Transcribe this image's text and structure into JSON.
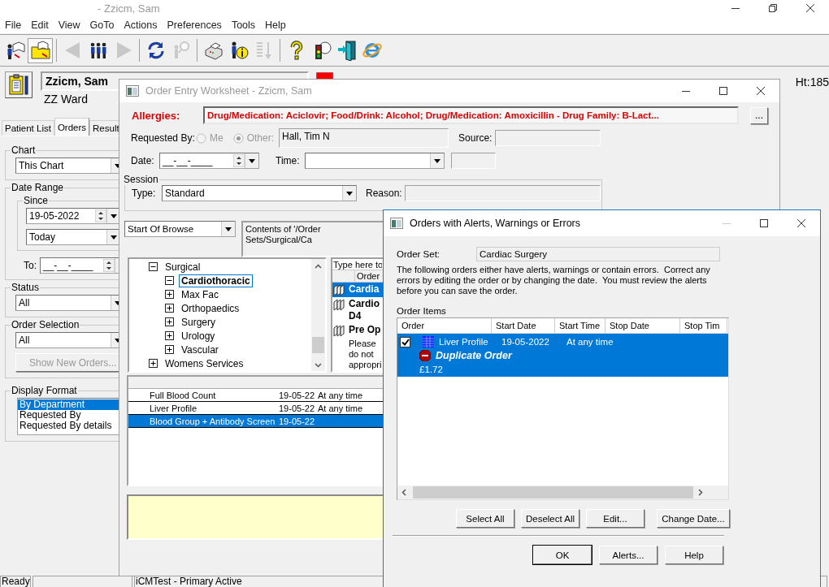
{
  "app": {
    "title": "- Zzicm, Sam",
    "menu": [
      "File",
      "Edit",
      "View",
      "GoTo",
      "Actions",
      "Preferences",
      "Tools",
      "Help"
    ],
    "toolbar": [
      [
        {
          "kind": "chart",
          "pressed": false,
          "disabled": false
        },
        {
          "kind": "folder",
          "pressed": true,
          "disabled": false
        }
      ],
      [
        {
          "kind": "back",
          "pressed": false,
          "disabled": true
        },
        {
          "kind": "people",
          "pressed": false,
          "disabled": false
        },
        {
          "kind": "forward",
          "pressed": false,
          "disabled": true
        }
      ],
      [
        {
          "kind": "refresh",
          "pressed": false,
          "disabled": false
        },
        {
          "kind": "find",
          "pressed": false,
          "disabled": true
        }
      ],
      [
        {
          "kind": "printer",
          "pressed": false,
          "disabled": false
        },
        {
          "kind": "info",
          "pressed": false,
          "disabled": false
        },
        {
          "kind": "sort",
          "pressed": false,
          "disabled": true
        }
      ],
      [
        {
          "kind": "help",
          "pressed": false,
          "disabled": false
        },
        {
          "kind": "traffic",
          "pressed": false,
          "disabled": false
        },
        {
          "kind": "exit",
          "pressed": false,
          "disabled": false
        },
        {
          "kind": "browser",
          "pressed": false,
          "disabled": false
        }
      ]
    ],
    "patient": {
      "name": "Zzicm, Sam",
      "ward": "ZZ Ward",
      "height": "Ht:185"
    }
  },
  "left_panel": {
    "tabs": [
      {
        "label": "Patient List",
        "selected": false
      },
      {
        "label": "Orders",
        "selected": true
      },
      {
        "label": "Result",
        "selected": false
      }
    ],
    "chart": {
      "label": "Chart",
      "value": "This Chart"
    },
    "date_range": {
      "label": "Date Range",
      "since_label": "Since",
      "since_value": "19-05-2022",
      "period": "Today",
      "to_label": "To:",
      "to_value": "__-__-____"
    },
    "status": {
      "label": "Status",
      "value": "All"
    },
    "order_selection": {
      "label": "Order Selection",
      "value": "All",
      "button": {
        "label": "Show New Orders...",
        "disabled": true
      }
    },
    "display_format": {
      "label": "Display Format",
      "items": [
        {
          "label": "By Department",
          "selected": true
        },
        {
          "label": "Requested By",
          "selected": false
        },
        {
          "label": "Requested By details",
          "selected": false
        }
      ]
    }
  },
  "worksheet": {
    "title": "Order Entry Worksheet - Zzicm, Sam",
    "allergies_label": "Allergies:",
    "allergies": "Drug/Medication: Aciclovir; Food/Drink: Alcohol; Drug/Medication: Amoxicillin - Drug Family: B-Lact...",
    "allergies_button": "...",
    "requested_by_label": "Requested By:",
    "requester_options": [
      {
        "label": "Me",
        "selected": false,
        "disabled": true
      },
      {
        "label": "Other:",
        "selected": true,
        "disabled": true
      }
    ],
    "requested_by": "Hall, Tim N",
    "source_label": "Source:",
    "date_label": "Date:",
    "date_value": "__-__-____",
    "time_label": "Time:",
    "session": {
      "label": "Session",
      "type_label": "Type:",
      "type_value": "Standard",
      "reason_label": "Reason:"
    },
    "browse": "Start Of Browse",
    "contents": "Contents of '/Order Sets/Surgical/Ca",
    "tree": [
      {
        "label": "Surgical",
        "expanded": true,
        "selected": false,
        "children": [
          {
            "label": "Cardiothoracic",
            "expanded": true,
            "selected": true
          },
          {
            "label": "Max Fac",
            "expanded": false,
            "selected": false
          },
          {
            "label": "Orthopaedics",
            "expanded": false,
            "selected": false
          },
          {
            "label": "Surgery",
            "expanded": false,
            "selected": false
          },
          {
            "label": "Urology",
            "expanded": false,
            "selected": false
          },
          {
            "label": "Vascular",
            "expanded": false,
            "selected": false
          }
        ]
      },
      {
        "label": "Womens Services",
        "expanded": false,
        "selected": false
      }
    ],
    "order_list": {
      "search_placeholder": "Type here to",
      "column": "Order",
      "rows": [
        {
          "kind": "set",
          "lines": [
            "Cardia"
          ],
          "selected": true
        },
        {
          "kind": "set",
          "lines": [
            "Cardio",
            "D4"
          ],
          "selected": false
        },
        {
          "kind": "set",
          "lines": [
            "Pre Op"
          ],
          "selected": false
        },
        {
          "kind": "note",
          "lines": [
            "Please",
            "do not",
            "appropri"
          ],
          "selected": false
        }
      ]
    },
    "basket": [
      {
        "name": "Full Blood Count",
        "date": "19-05-22",
        "time": "At any time",
        "selected": false
      },
      {
        "name": "Liver Profile",
        "date": "19-05-22",
        "time": "At any time",
        "selected": false
      },
      {
        "name": "Blood Group + Antibody Screen",
        "date": "19-05-22",
        "selected": true
      }
    ]
  },
  "alerts_dialog": {
    "title": "Orders with Alerts, Warnings or Errors",
    "order_set_label": "Order Set:",
    "order_set": "Cardiac Surgery",
    "message": "The following orders either have alerts, warnings or contain errors.  Correct any errors by editing the order or by changing the date.  You must review the alerts before you can save the order.",
    "items_label": "Order Items",
    "columns": [
      "Order",
      "Start Date",
      "Start Time",
      "Stop Date",
      "Stop Tim"
    ],
    "rows": [
      {
        "checked": true,
        "selected": true,
        "order": "Liver Profile",
        "start_date": "19-05-2022",
        "start_time": "At any time",
        "alert": "Duplicate Order",
        "price": "£1.72"
      }
    ],
    "buttons": [
      "Select All",
      "Deselect All",
      "Edit...",
      "Change Date..."
    ],
    "footer_buttons": [
      {
        "label": "OK",
        "default": true
      },
      {
        "label": "Alerts...",
        "default": false
      },
      {
        "label": "Help",
        "default": false
      }
    ]
  },
  "status_bar": {
    "left": "Ready",
    "right": "iCMTest - Primary Active"
  }
}
